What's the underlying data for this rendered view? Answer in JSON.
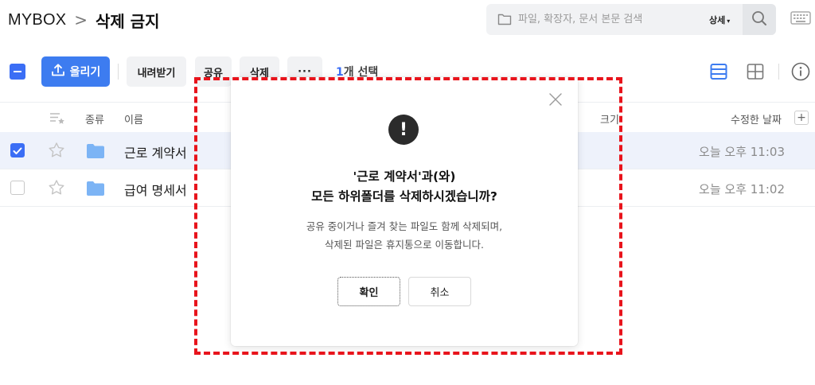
{
  "breadcrumb": {
    "root": "MYBOX",
    "separator": ">",
    "current": "삭제 금지"
  },
  "search": {
    "placeholder": "파일, 확장자, 문서 본문 검색",
    "detail_label": "상세",
    "detail_caret": "▾"
  },
  "toolbar": {
    "upload_label": "올리기",
    "download_label": "내려받기",
    "share_label": "공유",
    "delete_label": "삭제",
    "more_label": "···",
    "selected_count": "1",
    "selected_suffix": "개 선택"
  },
  "table": {
    "columns": {
      "type": "종류",
      "name": "이름",
      "size": "크기",
      "modified": "수정한 날짜",
      "add_column": "+"
    },
    "rows": [
      {
        "name": "근로 계약서",
        "modified": "오늘 오후 11:03",
        "selected": true
      },
      {
        "name": "급여 명세서",
        "modified": "오늘 오후 11:02",
        "selected": false
      }
    ]
  },
  "dialog": {
    "alert_glyph": "!",
    "title_line1": "'근로 계약서'과(와)",
    "title_line2": "모든 하위폴더를 삭제하시겠습니까?",
    "message_line1": "공유 중이거나 즐겨 찾는 파일도 함께 삭제되며,",
    "message_line2": "삭제된 파일은 휴지통으로 이동합니다.",
    "confirm_label": "확인",
    "cancel_label": "취소"
  },
  "colors": {
    "accent": "#3d7cf0",
    "highlight_frame": "#e8141c",
    "selected_row": "#eef2fb"
  },
  "icons": {
    "search_folder": "folder-outline-icon",
    "search": "magnifier-icon",
    "keyboard": "keyboard-icon",
    "upload": "upload-arrow-icon",
    "list_view": "list-view-icon",
    "grid_view": "grid-view-icon",
    "info": "info-icon",
    "sort": "sort-star-icon",
    "star": "star-outline-icon",
    "folder": "folder-icon",
    "close": "close-icon",
    "check": "check-icon"
  }
}
